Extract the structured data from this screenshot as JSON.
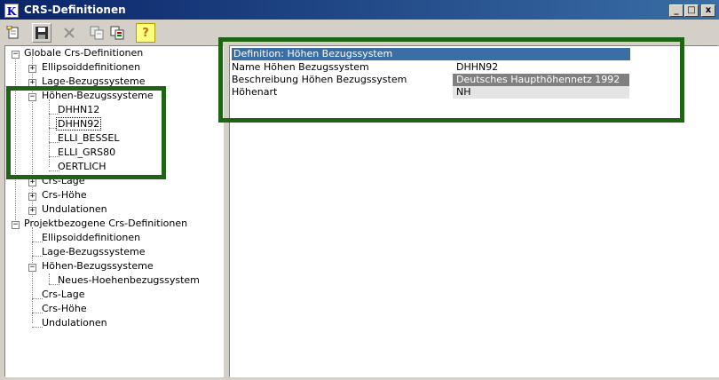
{
  "window": {
    "title": "CRS-Definitionen",
    "app_icon_letter": "K",
    "controls": {
      "minimize": "_",
      "maximize": "□",
      "close": "x"
    }
  },
  "toolbar": {
    "items": [
      {
        "name": "new-icon",
        "enabled": true
      },
      {
        "name": "save-icon",
        "enabled": true
      },
      {
        "name": "delete-icon",
        "enabled": false
      },
      {
        "name": "copy-icon",
        "enabled": false
      },
      {
        "name": "paste-icon",
        "enabled": true
      },
      {
        "name": "help-icon",
        "enabled": true
      }
    ],
    "help_label": "?"
  },
  "tree": {
    "global_root": "Globale Crs-Definitionen",
    "global_children": [
      "Ellipsoiddefinitionen",
      "Lage-Bezugssysteme",
      "Höhen-Bezugssysteme",
      "Crs-Lage",
      "Crs-Höhe",
      "Undulationen"
    ],
    "hoehen_children": [
      "DHHN12",
      "DHHN92",
      "ELLI_BESSEL",
      "ELLI_GRS80",
      "OERTLICH"
    ],
    "selected": "DHHN92",
    "project_root": "Projektbezogene Crs-Definitionen",
    "project_children": [
      "Ellipsoiddefinitionen",
      "Lage-Bezugssysteme",
      "Höhen-Bezugssysteme",
      "Crs-Lage",
      "Crs-Höhe",
      "Undulationen"
    ],
    "project_hoehen_children": [
      "Neues-Hoehenbezugssystem"
    ]
  },
  "definition": {
    "header": "Definition: Höhen Bezugssystem",
    "rows": [
      {
        "name": "Name Höhen Bezugssystem",
        "value": "DHHN92"
      },
      {
        "name": "Beschreibung Höhen Bezugssystem",
        "value": "Deutsches Haupthöhennetz 1992"
      },
      {
        "name": "Höhenart",
        "value": "NH"
      }
    ]
  },
  "colors": {
    "title_bar": "#0a246a",
    "header_row": "#3a6ea5",
    "highlight_outline": "#1e6414",
    "selected_value_bg": "#808080",
    "value_bg": "#d4d0c8"
  }
}
